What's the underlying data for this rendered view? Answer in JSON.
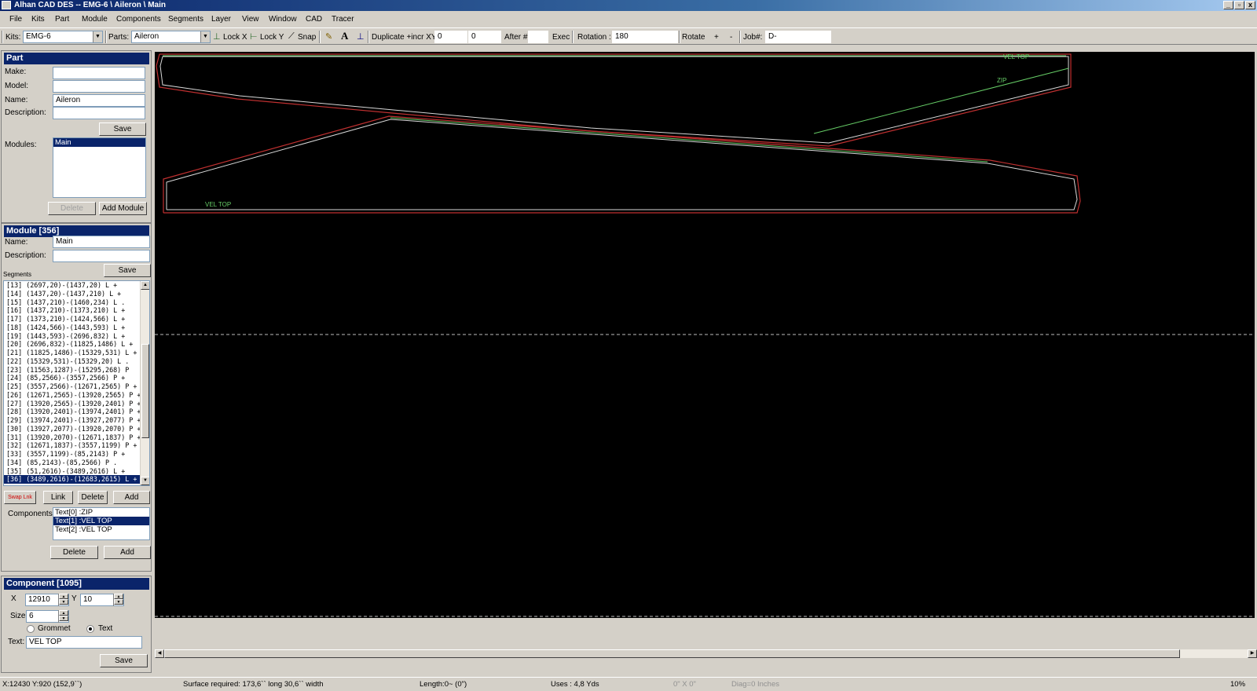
{
  "window": {
    "title": "Alhan CAD DES -- EMG-6 \\ Aileron \\ Main"
  },
  "menu": [
    "File",
    "Kits",
    "Part",
    "Module",
    "Components",
    "Segments",
    "Layer",
    "View",
    "Window",
    "CAD",
    "Tracer"
  ],
  "toolbar": {
    "kits_label": "Kits:",
    "kits_value": "EMG-6",
    "parts_label": "Parts:",
    "parts_value": "Aileron",
    "lock_x": "Lock X",
    "lock_y": "Lock Y",
    "snap": "Snap",
    "duplicate_label": "Duplicate +incr XY:",
    "dup_x": "0",
    "dup_y": "0",
    "after_label": "After #",
    "after_value": "",
    "exec": "Exec",
    "rotation_label": "Rotation :",
    "rotation_value": "180",
    "rotate_label": "Rotate",
    "rotate_plus": "+",
    "rotate_minus": "-",
    "job_label": "Job#:",
    "job_value": "D-"
  },
  "part_panel": {
    "header": "Part",
    "make_label": "Make:",
    "make_value": "",
    "model_label": "Model:",
    "model_value": "",
    "name_label": "Name:",
    "name_value": "Aileron",
    "description_label": "Description:",
    "description_value": "",
    "save": "Save",
    "modules_label": "Modules:",
    "modules": [
      "Main"
    ],
    "delete": "Delete",
    "add_module": "Add Module"
  },
  "module_panel": {
    "header": "Module [356]",
    "name_label": "Name:",
    "name_value": "Main",
    "description_label": "Description:",
    "description_value": "",
    "save": "Save",
    "segments_label": "Segments",
    "segments": [
      "[13] (2697,20)-(1437,20) L +",
      "[14] (1437,20)-(1437,210) L +",
      "[15] (1437,210)-(1460,234) L .",
      "[16] (1437,210)-(1373,210) L +",
      "[17] (1373,210)-(1424,566) L +",
      "[18] (1424,566)-(1443,593) L +",
      "[19] (1443,593)-(2696,832) L +",
      "[20] (2696,832)-(11825,1486) L +",
      "[21] (11825,1486)-(15329,531) L +",
      "[22] (15329,531)-(15329,20) L .",
      "[23] (11563,1287)-(15295,268) P",
      "[24] (85,2566)-(3557,2566) P +",
      "[25] (3557,2566)-(12671,2565) P +",
      "[26] (12671,2565)-(13920,2565) P +",
      "[27] (13920,2565)-(13920,2401) P +",
      "[28] (13920,2401)-(13974,2401) P +",
      "[29] (13974,2401)-(13927,2077) P +",
      "[30] (13927,2077)-(13920,2070) P +",
      "[31] (13920,2070)-(12671,1837) P +",
      "[32] (12671,1837)-(3557,1199) P +",
      "[33] (3557,1199)-(85,2143) P +",
      "[34] (85,2143)-(85,2566) P .",
      "[35] (51,2616)-(3489,2616) L +",
      "[36] (3489,2616)-(12683,2615) L +"
    ],
    "swap_link": "Swap Lnk",
    "link": "Link",
    "delete": "Delete",
    "add": "Add",
    "components_label": "Components",
    "components": [
      "Text[0] :ZIP",
      "Text[1] :VEL TOP",
      "Text[2] :VEL TOP"
    ],
    "comp_delete": "Delete",
    "comp_add": "Add"
  },
  "component_panel": {
    "header": "Component [1095]",
    "x_label": "X",
    "x_value": "12910",
    "y_label": "Y",
    "y_value": "10",
    "size_label": "Size",
    "size_value": "6",
    "grommet": "Grommet",
    "text_option": "Text",
    "selected_option": "Text",
    "text_label": "Text:",
    "text_value": "VEL TOP",
    "save": "Save"
  },
  "canvas": {
    "labels": [
      "VEL TOP",
      "ZIP",
      "VEL TOP"
    ],
    "colors": {
      "background": "#000000",
      "outline_red": "#c03030",
      "outline_white": "#d8d8d8",
      "outline_green": "#66cc66",
      "text_green": "#66cc66",
      "dash": "#bbbbbb"
    }
  },
  "status": {
    "coords": "X:12430  Y:920   (152,9``)",
    "surface": "Surface required: 173,6`` long 30,6`` width",
    "length": "Length:0~     (0\")",
    "uses": "Uses : 4,8 Yds",
    "dims": "0\" X 0\"",
    "diag": "Diag=0 Inches",
    "zoom": "10%"
  }
}
